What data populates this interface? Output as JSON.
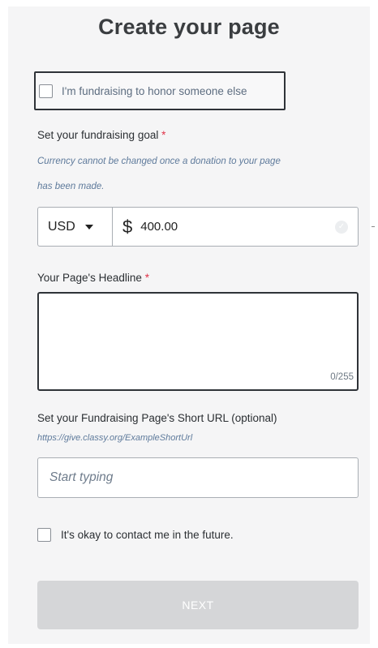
{
  "page": {
    "title": "Create your page"
  },
  "honor": {
    "label": "I'm fundraising to honor someone else"
  },
  "goal": {
    "label": "Set your fundraising goal",
    "required_mark": "*",
    "help_line1": "Currency cannot be changed once a donation to your page",
    "help_line2": "has been made.",
    "currency": "USD",
    "currency_symbol": "$",
    "amount": "400.00"
  },
  "headline": {
    "label": "Your Page's Headline",
    "required_mark": "*",
    "value": "",
    "counter": "0/255"
  },
  "short_url": {
    "label": "Set your Fundraising Page's Short URL (optional)",
    "example": "https://give.classy.org/ExampleShortUrl",
    "placeholder": "Start typing"
  },
  "contact": {
    "label": "It's okay to contact me in the future."
  },
  "actions": {
    "next_label": "NEXT"
  },
  "colors": {
    "required": "#e0344a",
    "help_text": "#5e7a9b",
    "button_disabled": "#d5d6d8"
  }
}
